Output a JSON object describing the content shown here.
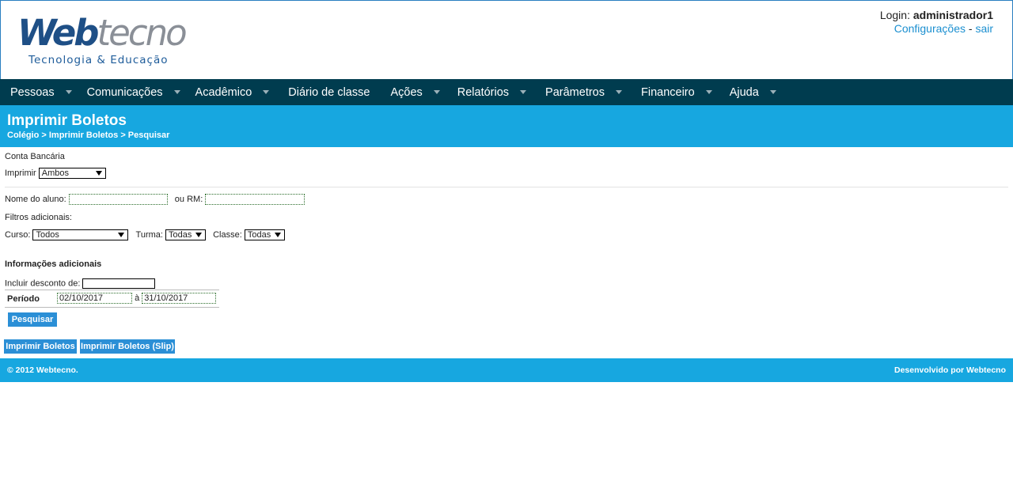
{
  "logo": {
    "web": "Web",
    "tecno": "tecno",
    "tagline": "Tecnologia & Educação"
  },
  "login": {
    "label": "Login:",
    "user": "administrador1",
    "settings": "Configurações",
    "separator": "-",
    "logout": "sair"
  },
  "nav": [
    {
      "label": "Pessoas",
      "arrow": true
    },
    {
      "label": "Comunicações",
      "arrow": true
    },
    {
      "label": "Acadêmico",
      "arrow": true
    },
    {
      "label": "Diário de classe",
      "arrow": false
    },
    {
      "label": "Ações",
      "arrow": true
    },
    {
      "label": "Relatórios",
      "arrow": true
    },
    {
      "label": "Parâmetros",
      "arrow": true
    },
    {
      "label": "Financeiro",
      "arrow": true
    },
    {
      "label": "Ajuda",
      "arrow": true
    }
  ],
  "page": {
    "title": "Imprimir Boletos",
    "breadcrumb": "Colégio  > Imprimir Boletos > Pesquisar"
  },
  "form": {
    "conta_label": "Conta Bancária",
    "imprimir_label": "Imprimir",
    "imprimir_value": "Ambos",
    "nome_label": "Nome do aluno:",
    "rm_label": "ou RM:",
    "filtros_label": "Filtros adicionais:",
    "curso_label": "Curso:",
    "curso_value": "Todos",
    "turma_label": "Turma:",
    "turma_value": "Todas",
    "classe_label": "Classe:",
    "classe_value": "Todas",
    "info_title": "Informações adicionais",
    "desconto_label": "Incluir desconto de:",
    "periodo_label": "Período",
    "periodo_start": "02/10/2017",
    "periodo_sep": "à",
    "periodo_end": "31/10/2017",
    "pesquisar": "Pesquisar"
  },
  "actions": {
    "imprimir": "Imprimir Boletos",
    "imprimir_slip": "Imprimir Boletos (Slip)"
  },
  "footer": {
    "copyright": "© 2012 Webtecno.",
    "credit": "Desenvolvido por Webtecno"
  },
  "colors": {
    "nav_bg": "#003c4f",
    "banner_bg": "#17a7e0",
    "button_bg": "#2b8fd6",
    "link": "#1b8fd0"
  }
}
